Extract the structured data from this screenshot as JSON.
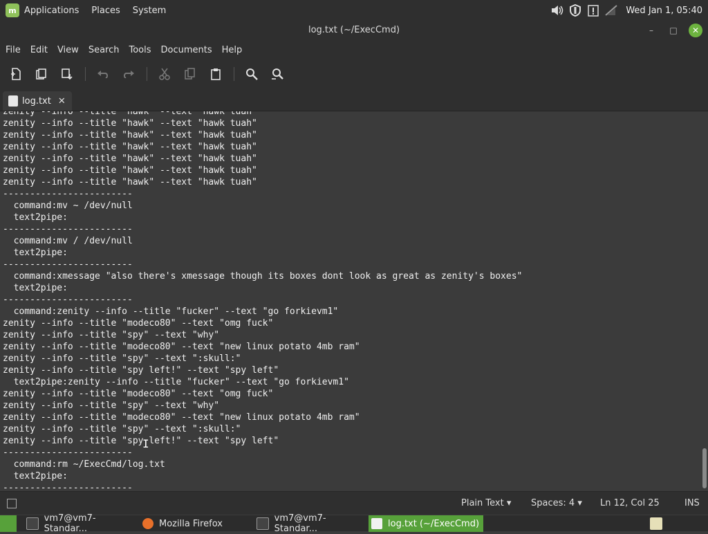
{
  "top_panel": {
    "menu": [
      "Applications",
      "Places",
      "System"
    ],
    "clock": "Wed Jan 1, 05:40",
    "tray_icons": [
      "volume-icon",
      "shield-icon",
      "clipboard-alert-icon",
      "network-off-icon"
    ]
  },
  "window": {
    "title": "log.txt (~/ExecCmd)"
  },
  "menubar": [
    "File",
    "Edit",
    "View",
    "Search",
    "Tools",
    "Documents",
    "Help"
  ],
  "toolbar_icons": [
    "new-document-icon",
    "open-document-icon",
    "save-icon",
    "undo-icon",
    "redo-icon",
    "cut-icon",
    "copy-icon",
    "paste-icon",
    "search-icon",
    "search-replace-icon"
  ],
  "tab": {
    "label": "log.txt",
    "close": "✕"
  },
  "editor": {
    "lines": [
      "zenity --info --title \"hawk\" --text \"hawk tuah\"",
      "zenity --info --title \"hawk\" --text \"hawk tuah\"",
      "zenity --info --title \"hawk\" --text \"hawk tuah\"",
      "zenity --info --title \"hawk\" --text \"hawk tuah\"",
      "zenity --info --title \"hawk\" --text \"hawk tuah\"",
      "zenity --info --title \"hawk\" --text \"hawk tuah\"",
      "zenity --info --title \"hawk\" --text \"hawk tuah\"",
      "------------------------",
      "  command:mv ~ /dev/null",
      "  text2pipe:",
      "------------------------",
      "  command:mv / /dev/null",
      "  text2pipe:",
      "------------------------",
      "  command:xmessage \"also there's xmessage though its boxes dont look as great as zenity's boxes\"",
      "  text2pipe:",
      "------------------------",
      "  command:zenity --info --title \"fucker\" --text \"go forkievm1\"",
      "zenity --info --title \"modeco80\" --text \"omg fuck\"",
      "zenity --info --title \"spy\" --text \"why\"",
      "zenity --info --title \"modeco80\" --text \"new linux potato 4mb ram\"",
      "zenity --info --title \"spy\" --text \":skull:\"",
      "zenity --info --title \"spy left!\" --text \"spy left\"",
      "  text2pipe:zenity --info --title \"fucker\" --text \"go forkievm1\"",
      "zenity --info --title \"modeco80\" --text \"omg fuck\"",
      "zenity --info --title \"spy\" --text \"why\"",
      "zenity --info --title \"modeco80\" --text \"new linux potato 4mb ram\"",
      "zenity --info --title \"spy\" --text \":skull:\"",
      "zenity --info --title \"spy left!\" --text \"spy left\"",
      "------------------------",
      "  command:rm ~/ExecCmd/log.txt",
      "  text2pipe:",
      "------------------------"
    ]
  },
  "statusbar": {
    "syntax": "Plain Text",
    "spaces": "Spaces: 4",
    "position": "Ln 12, Col 25",
    "mode": "INS"
  },
  "taskbar": {
    "tasks": [
      {
        "label": "vm7@vm7-Standar...",
        "icon": "terminal-icon"
      },
      {
        "label": "Mozilla Firefox",
        "icon": "firefox-icon"
      },
      {
        "label": "vm7@vm7-Standar...",
        "icon": "terminal-icon"
      },
      {
        "label": "log.txt (~/ExecCmd)",
        "icon": "text-editor-icon"
      }
    ]
  },
  "colors": {
    "accent": "#57a13a",
    "background": "#3b3b3b",
    "panel": "#2f2f2f"
  }
}
